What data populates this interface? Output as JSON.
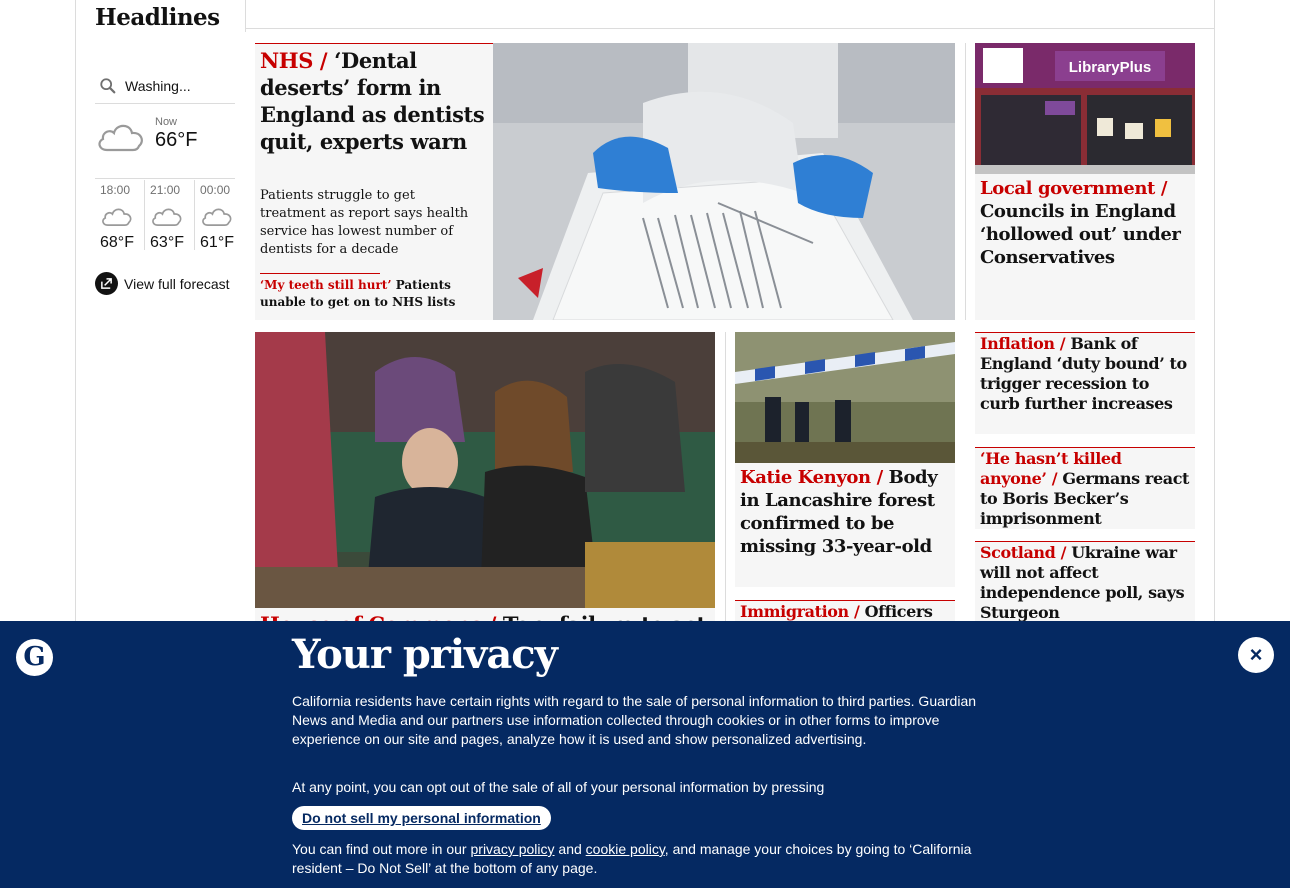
{
  "section": {
    "title": "Headlines"
  },
  "weather": {
    "location": "Washing...",
    "now_label": "Now",
    "now_temp": "66°F",
    "forecast": [
      {
        "time": "18:00",
        "temp": "68°F"
      },
      {
        "time": "21:00",
        "temp": "63°F"
      },
      {
        "time": "00:00",
        "temp": "61°F"
      }
    ],
    "full_forecast_label": "View full forecast",
    "icons": [
      "search-icon",
      "cloud-icon",
      "external-link-icon"
    ]
  },
  "stories": {
    "nhs": {
      "kicker": "NHS / ",
      "headline": "‘Dental deserts’ form in England as dentists quit, experts warn",
      "standfirst": "Patients struggle to get treatment as report says health service has lowest number of dentists for a decade",
      "sub_kicker": "‘My teeth still hurt’ ",
      "sub_headline": "Patients unable to get on to NHS lists"
    },
    "local_gov": {
      "kicker": "Local government / ",
      "headline": "Councils in England ‘hollowed out’ under Conservatives"
    },
    "commons": {
      "kicker": "House of Commons / ",
      "headline": "Tory failure to act"
    },
    "kenyon": {
      "kicker": "Katie Kenyon / ",
      "headline": "Body in Lancashire forest confirmed to be missing 33-year-old"
    },
    "immigration": {
      "kicker": "Immigration / ",
      "headline": "Officers"
    },
    "inflation": {
      "kicker": "Inflation / ",
      "headline": "Bank of England ‘duty bound’ to trigger recession to curb further increases"
    },
    "becker": {
      "kicker": "‘He hasn’t killed anyone’ / ",
      "headline": "Germans react to Boris Becker’s imprisonment"
    },
    "scotland": {
      "kicker": "Scotland / ",
      "headline": "Ukraine war will not affect independence poll, says Sturgeon"
    }
  },
  "privacy": {
    "logo": "G",
    "title": "Your privacy",
    "para1": "California residents have certain rights with regard to the sale of personal information to third parties. Guardian News and Media and our partners use information collected through cookies or in other forms to improve experience on our site and pages, analyze how it is used and show personalized advertising.",
    "para2": "At any point, you can opt out of the sale of all of your personal information by pressing",
    "button": "Do not sell my personal information",
    "para3_a": "You can find out more in our ",
    "privacy_link": "privacy policy",
    "para3_b": " and ",
    "cookie_link": "cookie policy",
    "para3_c": ", and manage your choices by going to ‘California resident – Do Not Sell’ at the bottom of any page.",
    "close_label": "×"
  },
  "colors": {
    "news_red": "#c70000",
    "guardian_blue": "#052962",
    "card_bg": "#f6f6f6"
  }
}
